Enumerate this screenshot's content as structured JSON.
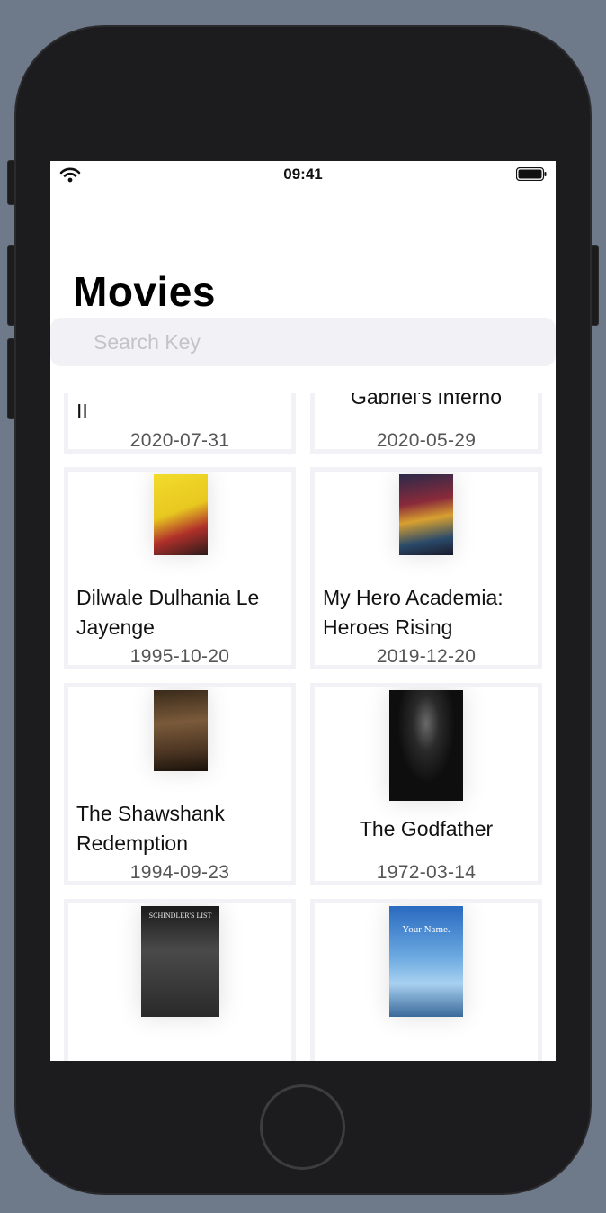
{
  "status_bar": {
    "time": "09:41"
  },
  "header": {
    "title": "Movies"
  },
  "search": {
    "placeholder": "Search Key",
    "value": ""
  },
  "movies": [
    {
      "title": "Gabriel's Inferno Part II",
      "date": "2020-07-31",
      "poster_color": "#3a2a20"
    },
    {
      "title": "Gabriel's Inferno",
      "date": "2020-05-29",
      "poster_color": "#8a3a14"
    },
    {
      "title": "Dilwale Dulhania Le Jayenge",
      "date": "1995-10-20",
      "poster_color": "#e8c820"
    },
    {
      "title": "My Hero Academia: Heroes Rising",
      "date": "2019-12-20",
      "poster_color": "#4a2a3a"
    },
    {
      "title": "The Shawshank Redemption",
      "date": "1994-09-23",
      "poster_color": "#6b4a2a"
    },
    {
      "title": "The Godfather",
      "date": "1972-03-14",
      "poster_color": "#111111"
    },
    {
      "title": "Schindler's List",
      "date": "",
      "poster_color": "#3a3a3a"
    },
    {
      "title": "Your Name.",
      "date": "",
      "poster_color": "#4a8ad0"
    }
  ],
  "posters": {
    "schindler_text": "SCHINDLER'S LIST",
    "your_name_text": "Your Name."
  }
}
